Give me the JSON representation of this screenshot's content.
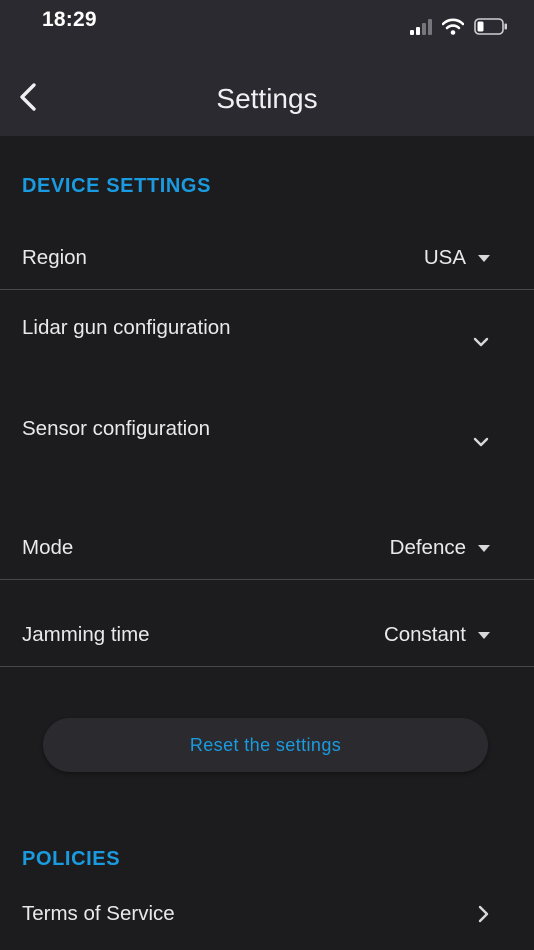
{
  "status_bar": {
    "time": "18:29",
    "icons": [
      "signal-icon",
      "wifi-icon",
      "battery-icon"
    ]
  },
  "header": {
    "title": "Settings",
    "back_icon": "chevron-left-icon"
  },
  "device_settings": {
    "title": "DEVICE SETTINGS",
    "region": {
      "label": "Region",
      "value": "USA"
    },
    "lidar": {
      "label": "Lidar gun configuration"
    },
    "sensor": {
      "label": "Sensor configuration"
    },
    "mode": {
      "label": "Mode",
      "value": "Defence"
    },
    "jamming": {
      "label": "Jamming time",
      "value": "Constant"
    },
    "reset_label": "Reset the settings"
  },
  "policies": {
    "title": "POLICIES",
    "terms": {
      "label": "Terms of Service"
    }
  },
  "colors": {
    "accent": "#1a9be0",
    "background": "#1c1c1f",
    "header": "#2b2a31"
  }
}
